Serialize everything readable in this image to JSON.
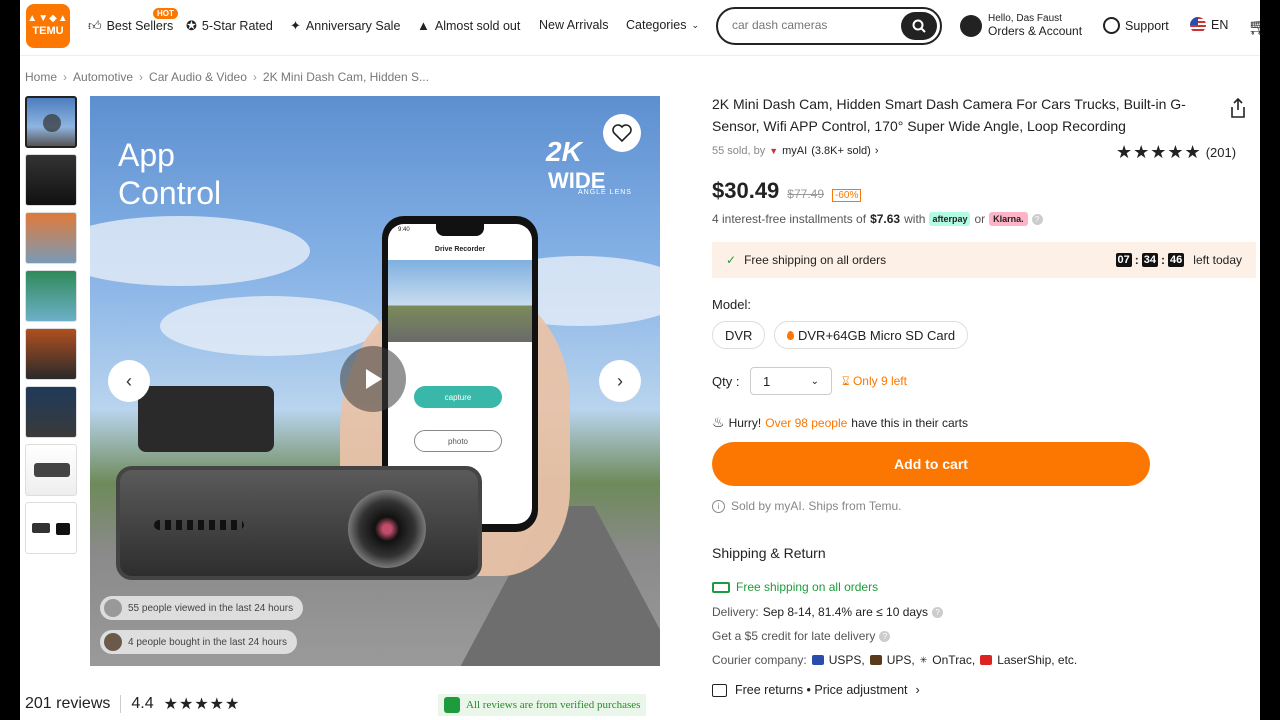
{
  "header": {
    "logo_text": "TEMU",
    "nav": [
      {
        "label": "Best Sellers",
        "icon": "thumbs-up-icon"
      },
      {
        "label": "5-Star Rated",
        "icon": "star-chat-icon"
      },
      {
        "label": "Anniversary Sale",
        "icon": "party-icon"
      },
      {
        "label": "Almost sold out",
        "icon": "flame-icon"
      },
      {
        "label": "New Arrivals",
        "icon": ""
      },
      {
        "label": "Categories",
        "icon": "chevron-down-icon"
      }
    ],
    "hot_badge": "HOT",
    "search_value": "car dash cameras",
    "account_greeting": "Hello, Das Faust",
    "account_label": "Orders & Account",
    "support_label": "Support",
    "lang_label": "EN"
  },
  "breadcrumb": [
    "Home",
    "Automotive",
    "Car Audio & Video",
    "2K Mini Dash Cam, Hidden S..."
  ],
  "gallery": {
    "title_line1": "App",
    "title_line2": "Control",
    "badge_2k": "2K",
    "badge_wide": "WIDE",
    "badge_wide_sub": "ANGLE LENS",
    "phone_time": "9:40",
    "phone_title": "Drive Recorder",
    "phone_capture": "capture",
    "phone_photo": "photo",
    "viewed": "55 people viewed in the last 24 hours",
    "bought": "4 people bought in the last 24 hours"
  },
  "reviews": {
    "count": "201 reviews",
    "score": "4.4",
    "stars": "★★★★★",
    "verified": "All reviews are from verified purchases"
  },
  "product": {
    "title": "2K Mini Dash Cam, Hidden Smart Dash Camera For Cars Trucks, Built-in G-Sensor, Wifi APP Control, 170° Super Wide Angle, Loop Recording",
    "sold_text": "55 sold, by",
    "store": "myAI",
    "store_sold": "(3.8K+ sold)",
    "rating_stars": "★★★★★",
    "rating_count": "(201)",
    "price": "$30.49",
    "old_price": "$77.49",
    "discount": "-60%",
    "install_prefix": "4 interest-free installments of",
    "install_amount": "$7.63",
    "install_with": "with",
    "afterpay": "afterpay",
    "or": "or",
    "klarna": "Klarna.",
    "ship_banner": "Free shipping on all orders",
    "timer_h": "07",
    "timer_m": "34",
    "timer_s": "46",
    "timer_suffix": "left today",
    "model_label": "Model:",
    "options": [
      "DVR",
      "DVR+64GB Micro SD Card"
    ],
    "qty_label": "Qty :",
    "qty_value": "1",
    "only_left": "Only 9 left",
    "hurry": "Hurry!",
    "hurry_orange": "Over 98 people",
    "hurry_suffix": "have this in their carts",
    "add_to_cart": "Add to cart",
    "sold_by": "Sold by myAI. Ships from Temu.",
    "ship_heading": "Shipping & Return",
    "free_ship": "Free shipping on all orders",
    "delivery_prefix": "Delivery:",
    "delivery_value": "Sep 8-14, 81.4% are ≤ 10 days",
    "credit": "Get a $5 credit for late delivery",
    "courier_prefix": "Courier company:",
    "couriers": [
      "USPS,",
      "UPS,",
      "OnTrac,",
      "LaserShip, etc."
    ],
    "returns": "Free returns • Price adjustment"
  },
  "colors": {
    "brand": "#fb7701",
    "green": "#1e9b3c"
  }
}
